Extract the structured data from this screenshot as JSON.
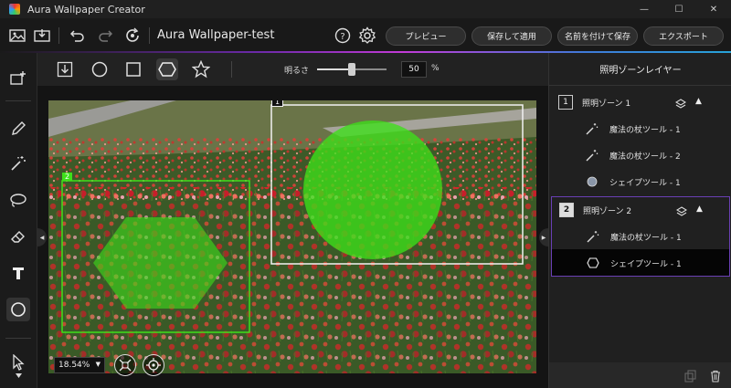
{
  "window": {
    "app_title": "Aura Wallpaper Creator",
    "minimize": "—",
    "maximize": "☐",
    "close": "✕"
  },
  "toolbar": {
    "doc_title": "Aura Wallpaper-test",
    "preview_label": "プレビュー",
    "save_apply_label": "保存して適用",
    "save_as_label": "名前を付けて保存",
    "export_label": "エクスポート"
  },
  "shapebar": {
    "brightness_label": "明るさ",
    "brightness_value": "50",
    "brightness_unit": "%",
    "brightness_level": 0.5
  },
  "canvas": {
    "zoom": "18.54%",
    "zone1_tag": "1",
    "zone2_tag": "2"
  },
  "panel": {
    "title": "照明ゾーンレイヤー",
    "zones": [
      {
        "number": "1",
        "name": "照明ゾーン 1",
        "items": [
          {
            "label": "魔法の杖ツール - 1",
            "icon": "magic-wand-icon"
          },
          {
            "label": "魔法の杖ツール - 2",
            "icon": "magic-wand-icon"
          },
          {
            "label": "シェイプツール - 1",
            "icon": "circle-shape-icon"
          }
        ]
      },
      {
        "number": "2",
        "name": "照明ゾーン 2",
        "items": [
          {
            "label": "魔法の杖ツール - 1",
            "icon": "magic-wand-icon"
          },
          {
            "label": "シェイプツール - 1",
            "icon": "hexagon-shape-icon"
          }
        ]
      }
    ]
  },
  "colors": {
    "zone_green": "#39e81f",
    "selection_purple": "#6a3fb5",
    "accent_gradient_end": "#27a3d8"
  }
}
